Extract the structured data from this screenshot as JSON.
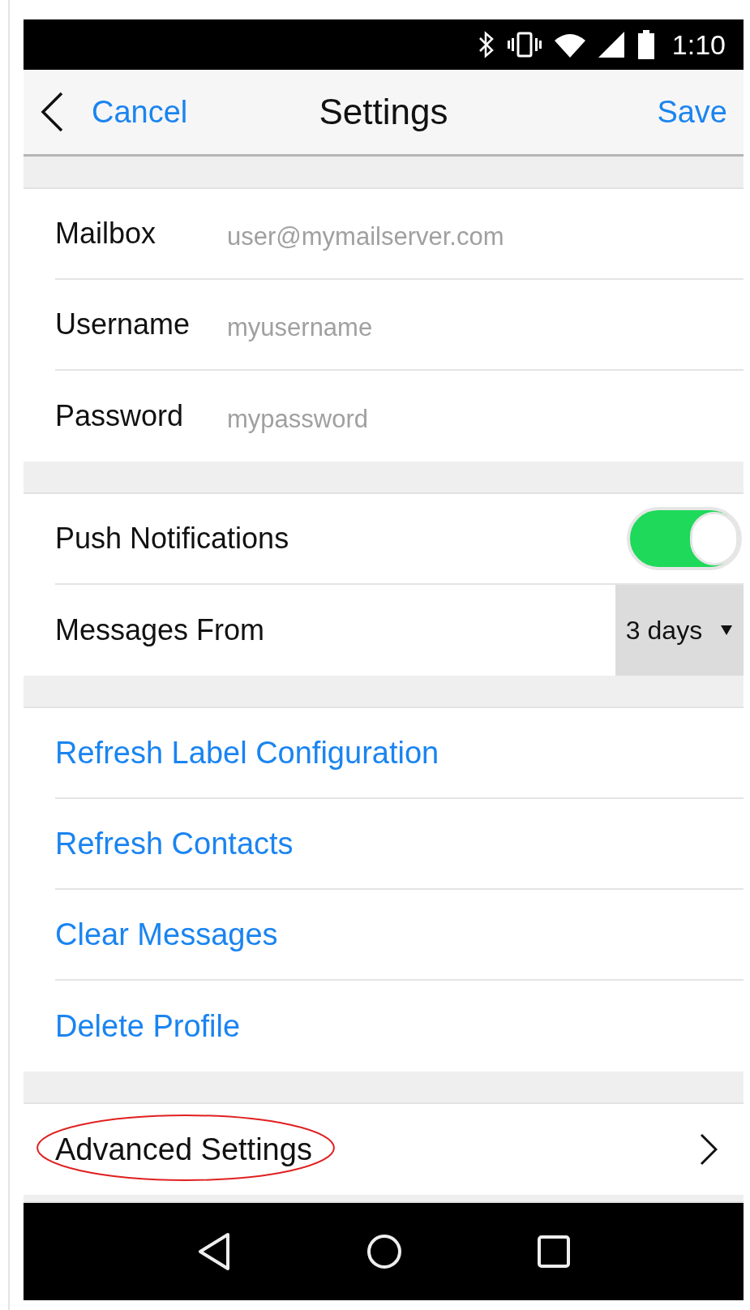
{
  "status_bar": {
    "time": "1:10"
  },
  "nav": {
    "back_label": "Cancel",
    "title": "Settings",
    "action": "Save"
  },
  "account_fields": [
    {
      "label": "Mailbox",
      "placeholder": "user@mymailserver.com"
    },
    {
      "label": "Username",
      "placeholder": "myusername"
    },
    {
      "label": "Password",
      "placeholder": "mypassword"
    }
  ],
  "options": [
    {
      "kind": "toggle",
      "label": "Push Notifications",
      "on": true
    },
    {
      "kind": "dropdown",
      "label": "Messages From",
      "value": "3 days"
    }
  ],
  "actions": [
    {
      "label": "Refresh Label Configuration"
    },
    {
      "label": "Refresh Contacts"
    },
    {
      "label": "Clear Messages"
    },
    {
      "label": "Delete Profile"
    }
  ],
  "advanced": {
    "label": "Advanced Settings",
    "highlighted": true
  }
}
